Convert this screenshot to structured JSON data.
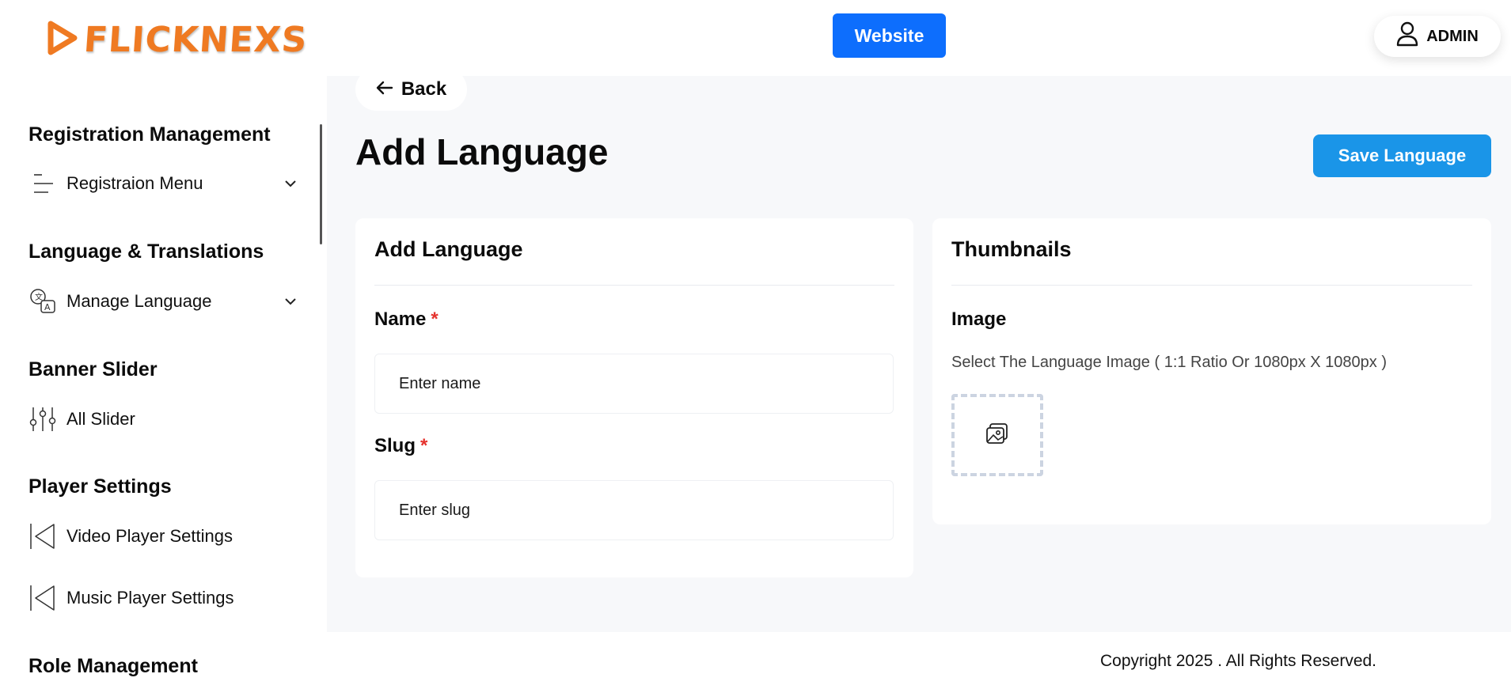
{
  "header": {
    "logo_text": "FLICKNEXS",
    "website_label": "Website",
    "admin_label": "ADMIN",
    "brand_color": "#ef7a22",
    "primary_color": "#0d6efd"
  },
  "sidebar": {
    "sections": [
      {
        "title": "Registration Management",
        "items": [
          {
            "label": "Registraion Menu",
            "icon": "menu-lines-icon",
            "has_chevron": true
          }
        ]
      },
      {
        "title": "Language & Translations",
        "items": [
          {
            "label": "Manage Language",
            "icon": "translate-icon",
            "has_chevron": true
          }
        ]
      },
      {
        "title": "Banner Slider",
        "items": [
          {
            "label": "All Slider",
            "icon": "sliders-icon",
            "has_chevron": false
          }
        ]
      },
      {
        "title": "Player Settings",
        "items": [
          {
            "label": "Video Player Settings",
            "icon": "player-icon",
            "has_chevron": false
          },
          {
            "label": "Music Player Settings",
            "icon": "player-icon",
            "has_chevron": false
          }
        ]
      },
      {
        "title": "Role Management",
        "items": []
      }
    ]
  },
  "main": {
    "back_label": "Back",
    "page_title": "Add Language",
    "save_label": "Save Language",
    "save_color": "#1a95e8",
    "form_card": {
      "title": "Add Language",
      "name_label": "Name",
      "name_placeholder": "Enter name",
      "slug_label": "Slug",
      "slug_placeholder": "Enter slug",
      "required_mark": "*"
    },
    "thumb_card": {
      "title": "Thumbnails",
      "image_label": "Image",
      "helper_text": "Select The Language Image ( 1:1 Ratio Or 1080px X 1080px )",
      "upload_icon": "image-upload-icon"
    }
  },
  "footer": {
    "copyright": "Copyright 2025  . All Rights Reserved."
  }
}
